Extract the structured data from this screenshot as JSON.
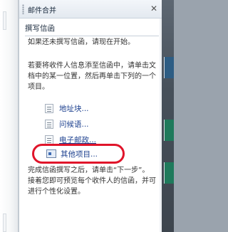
{
  "pane": {
    "title": "邮件合并",
    "close_glyph": "✕"
  },
  "section": {
    "heading": "撰写信函"
  },
  "instructions": {
    "p1": "如果还未撰写信函，请现在开始。",
    "p2": "若要将收件人信息添至信函中，请单击文档中的某一位置，然后再单击下列的一个项目。",
    "p3": "完成信函撰写之后，请单击“下一步”。接着您即可预览每个收件人的信函，并可进行个性化设置。"
  },
  "items": [
    {
      "label": "地址块",
      "dots": "..."
    },
    {
      "label": "问候语",
      "dots": "..."
    },
    {
      "label": "电子邮政",
      "dots": "..."
    },
    {
      "label": "其他项目",
      "dots": "..."
    }
  ],
  "icons": [
    "address-block-icon",
    "greeting-line-icon",
    "electronic-postage-icon",
    "more-items-icon"
  ],
  "colors": {
    "highlight": "#e0142a",
    "link": "#1b3f8e"
  }
}
